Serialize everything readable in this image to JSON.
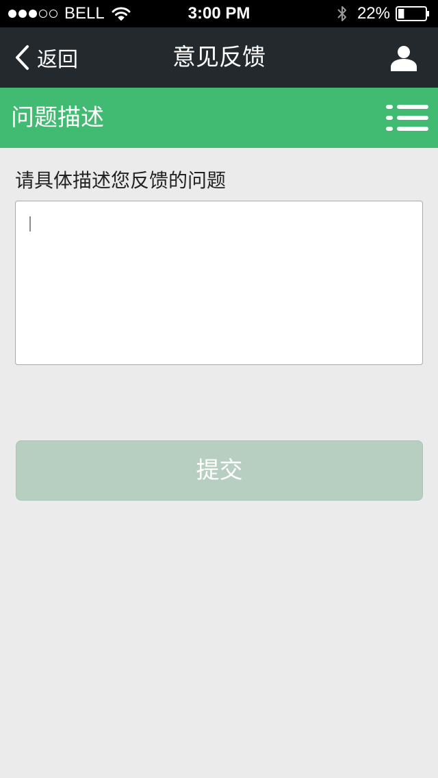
{
  "status_bar": {
    "signal_filled": 3,
    "signal_total": 5,
    "carrier": "BELL",
    "time": "3:00 PM",
    "battery": "22%",
    "battery_level": 0.22,
    "icons": [
      "wifi-icon",
      "bluetooth-icon",
      "battery-icon"
    ]
  },
  "nav": {
    "back_label": "返回",
    "title": "意见反馈",
    "back_icon": "chevron-left-icon",
    "user_icon": "user-icon"
  },
  "section": {
    "title": "问题描述",
    "menu_icon": "list-menu-icon"
  },
  "form": {
    "prompt": "请具体描述您反馈的问题",
    "textarea_value": "",
    "submit_label": "提交"
  },
  "colors": {
    "status_bar_bg": "#000000",
    "nav_bg": "#24292d",
    "accent_green": "#41bb72",
    "page_bg": "#ebebeb",
    "submit_disabled": "#b6cfc1"
  }
}
